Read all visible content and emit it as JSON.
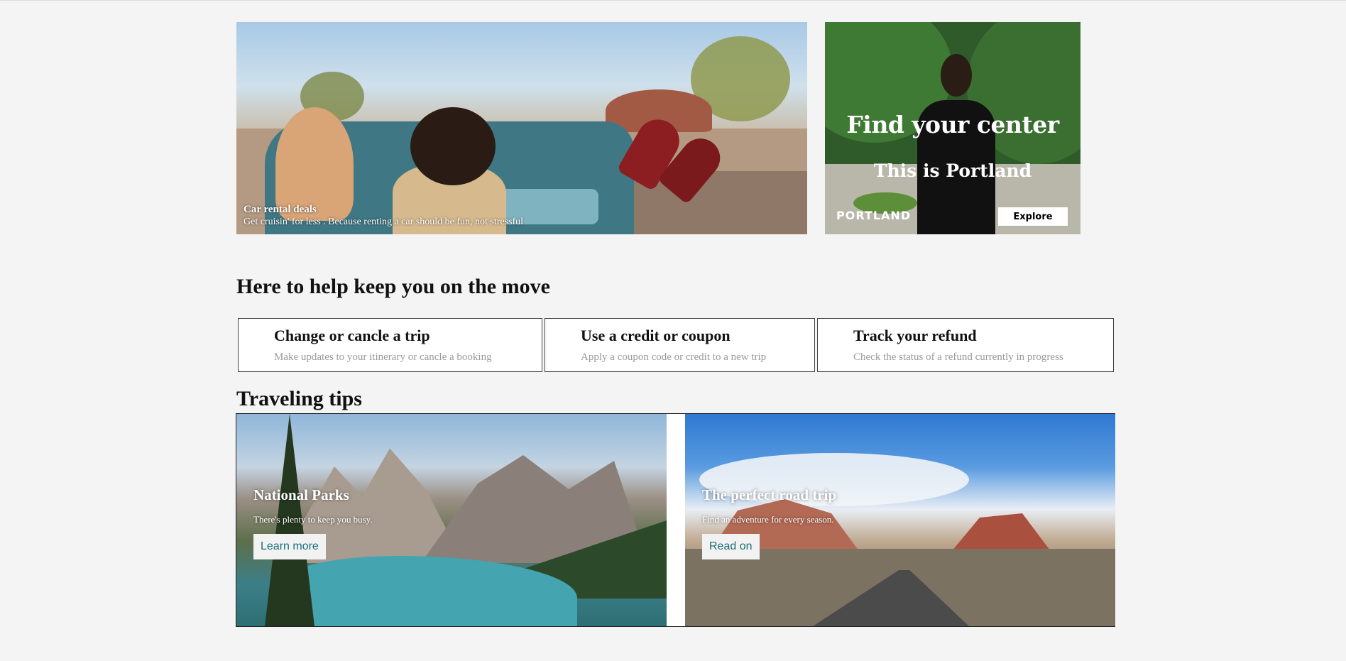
{
  "hero": {
    "title": "Car rental deals",
    "subtitle": "Get cruisin' for less . Because renting a car should be fun, not stressful"
  },
  "ad": {
    "headline": "Find your center",
    "subheadline": "This is Portland",
    "brand": "PORTLAND",
    "button_label": "Explore"
  },
  "help": {
    "title": "Here to help keep you on the move",
    "cards": [
      {
        "title": "Change or cancle a trip",
        "description": "Make updates to your itinerary or cancle a booking"
      },
      {
        "title": "Use a credit or coupon",
        "description": "Apply a coupon code or credit to a new trip"
      },
      {
        "title": "Track your refund",
        "description": "Check the status of a refund currently in progress"
      }
    ]
  },
  "tips": {
    "title": "Traveling tips",
    "items": [
      {
        "heading": "National Parks",
        "description": "There's plenty to keep you busy.",
        "button": "Learn more"
      },
      {
        "heading": "The perfect road trip",
        "description": "Find an adventure for every season.",
        "button": "Read on"
      }
    ]
  },
  "colors": {
    "page_background": "#f4f4f4",
    "button_text": "#1b6f74",
    "card_description": "#9a9a9a"
  }
}
